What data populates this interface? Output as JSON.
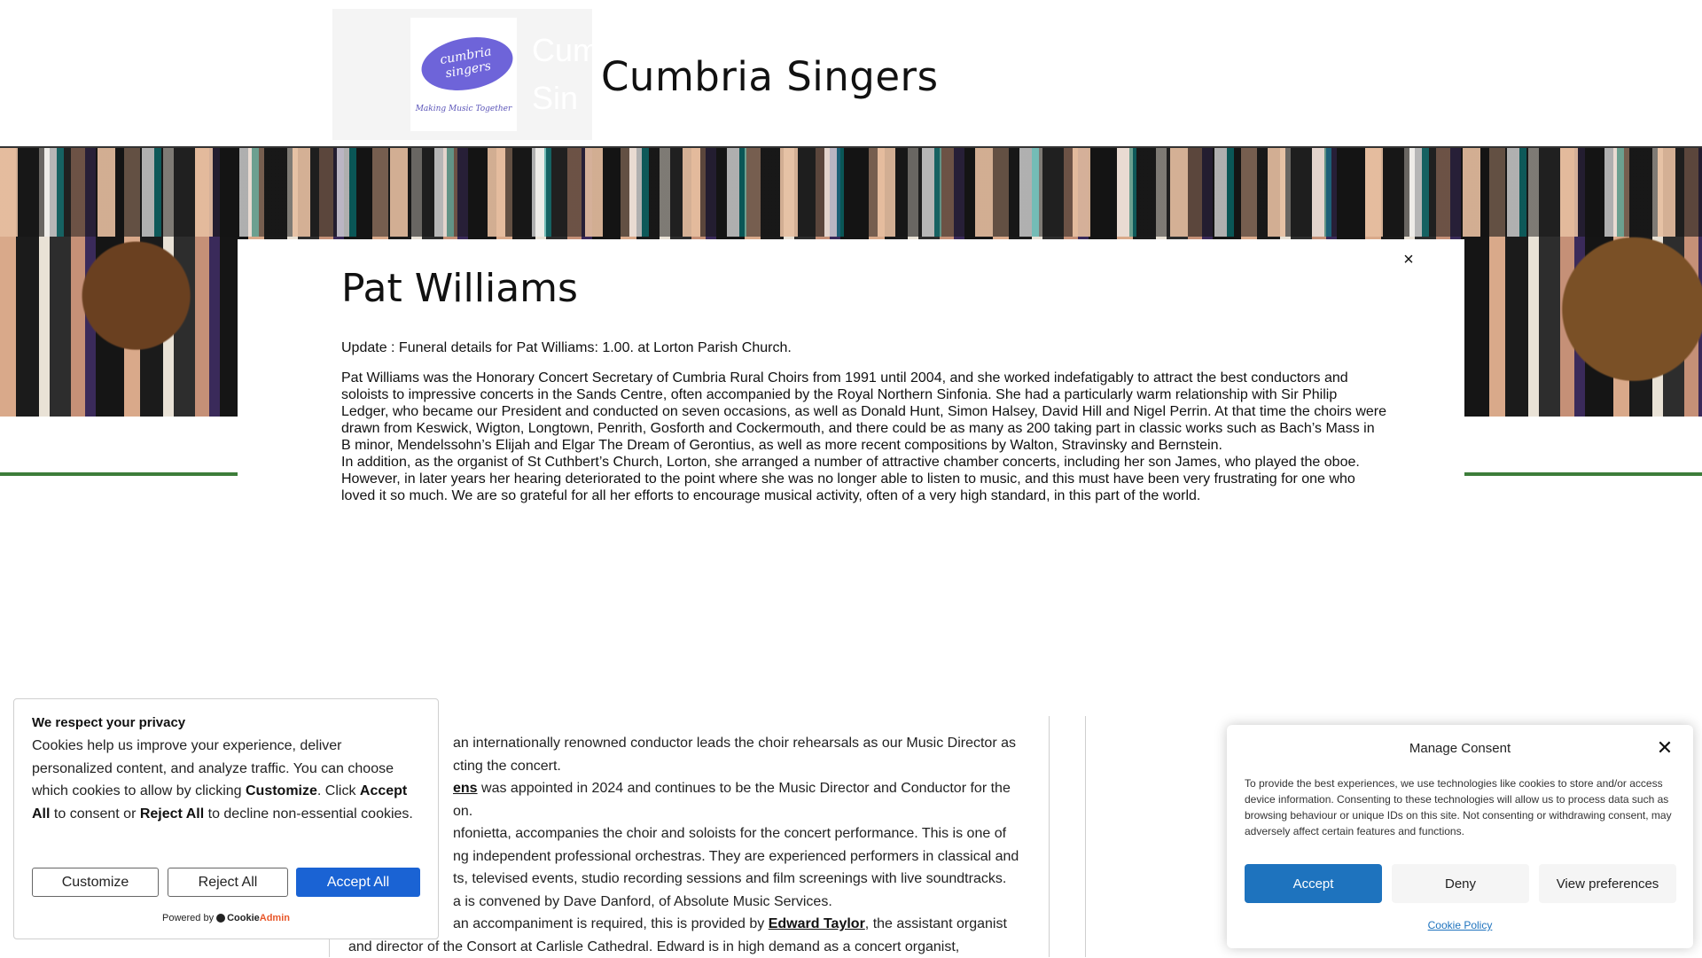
{
  "header": {
    "site_title": "Cumbria Singers",
    "logo": {
      "line1": "cumbria",
      "line2": "singers",
      "tagline": "Making Music Together",
      "ghost1": "Cum",
      "ghost2": "Sin"
    }
  },
  "modal": {
    "title": "Pat Williams",
    "close_icon": "×",
    "update": "Update : Funeral details for Pat Williams:  1.00. at Lorton Parish Church.",
    "paragraph1": "Pat Williams was the Honorary Concert Secretary of Cumbria Rural Choirs from 1991 until 2004, and she worked indefatigably to attract the best conductors and soloists to impressive concerts in the Sands Centre, often accompanied by the Royal Northern Sinfonia. She had a particularly warm relationship with Sir Philip Ledger, who became our President and conducted on seven occasions, as well as Donald Hunt, Simon Halsey, David Hill and Nigel Perrin. At that time the choirs were drawn from Keswick, Wigton, Longtown, Penrith, Gosforth and Cockermouth, and there could be as many as 200 taking part in classic works such as Bach’s Mass in B minor, Mendelssohn’s Elijah and Elgar The Dream of Gerontius, as well as more recent compositions by Walton, Stravinsky and Bernstein.",
    "paragraph2": "In addition, as the organist of St Cuthbert’s Church, Lorton, she arranged a number of attractive chamber concerts, including her son James, who played the oboe. However, in later years her hearing deteriorated to the point where she was no longer able to listen to music, and this must have been very frustrating for one who loved it so much. We are so grateful for all her efforts to encourage musical activity, often of a very high standard, in this part of the world."
  },
  "page": {
    "line1": "an internationally renowned conductor leads the choir rehearsals as our Music Director as",
    "line2": "cting the concert.",
    "line3_link": "ens",
    "line3_rest": " was appointed in 2024 and continues to be the Music Director and Conductor for the",
    "line4": "on.",
    "line5": "nfonietta, accompanies the choir and soloists for the concert performance. This is one of",
    "line6": "ng independent professional orchestras. They are experienced performers in classical and",
    "line7": "ts, televised events, studio recording sessions and film screenings with live soundtracks.",
    "line8": "a is convened by Dave Danford,  of Absolute Music Services.",
    "line9_pre": "an accompaniment is required, this is provided by ",
    "line9_link": "Edward Taylor",
    "line9_post": ", the assistant organist",
    "line10": "and director of the Consort at Carlisle Cathedral. Edward is in high demand as a concert organist,"
  },
  "privacy": {
    "title": "We respect your privacy",
    "text_a": "Cookies help us improve your experience, deliver personalized content, and analyze traffic. You can choose which cookies to allow by clicking ",
    "text_b": "Customize",
    "text_c": ". Click ",
    "text_d": "Accept All",
    "text_e": " to consent or ",
    "text_f": "Reject All",
    "text_g": " to decline non-essential cookies.",
    "customize_label": "Customize",
    "reject_label": "Reject All",
    "accept_label": "Accept All",
    "powered_by": "Powered by",
    "brand_cookie": "Cookie",
    "brand_admin": "Admin"
  },
  "consent": {
    "title": "Manage Consent",
    "close_icon": "✕",
    "text": "To provide the best experiences, we use technologies like cookies to store and/or access device information. Consenting to these technologies will allow us to process data such as browsing behaviour or unique IDs on this site. Not consenting or withdrawing consent, may adversely affect certain features and functions.",
    "accept_label": "Accept",
    "deny_label": "Deny",
    "preferences_label": "View preferences",
    "policy_link": "Cookie Policy"
  },
  "colors": {
    "accent_blue": "#1e73be",
    "cookieadmin_blue": "#1a63d4",
    "green_rule": "#3d7d3a",
    "logo_purple": "#6e64d9"
  }
}
